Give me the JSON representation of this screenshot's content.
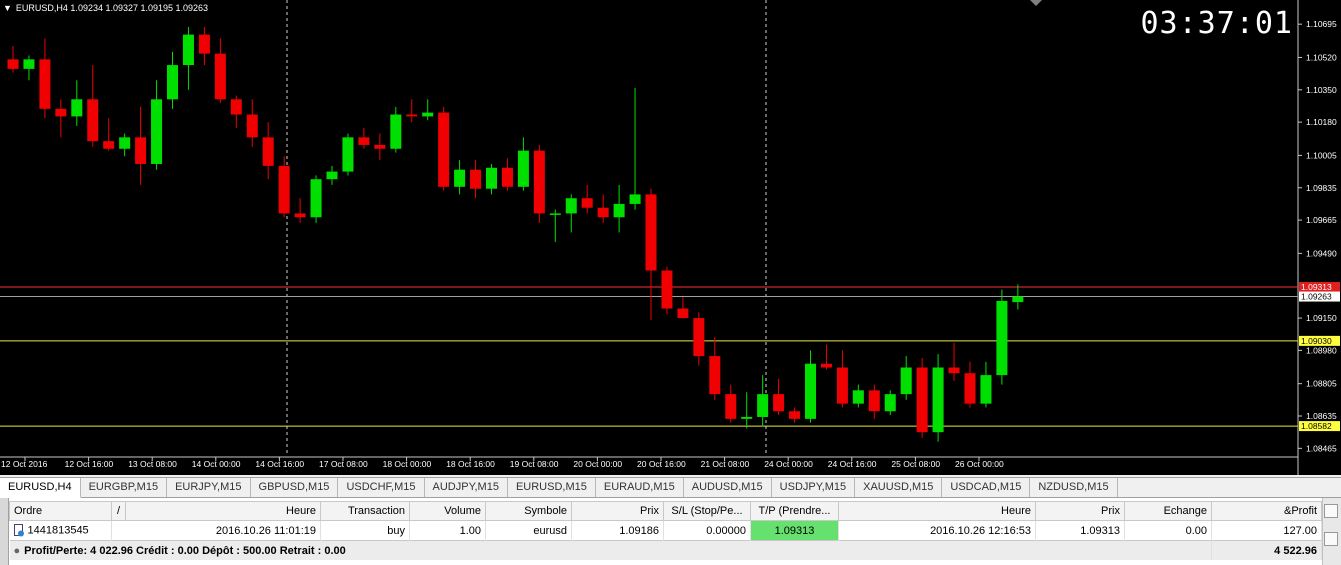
{
  "chart": {
    "symbol_info": "EURUSD,H4  1.09234 1.09327 1.09195 1.09263",
    "clock": "03:37:01",
    "price_min": 1.0843,
    "price_max": 1.1078,
    "price_ticks": [
      "1.10695",
      "1.10520",
      "1.10350",
      "1.10180",
      "1.10005",
      "1.09835",
      "1.09665",
      "1.09490",
      "1.09150",
      "1.08980",
      "1.08805",
      "1.08635",
      "1.08465"
    ],
    "time_ticks": [
      "12 Oct 2016",
      "12 Oct 16:00",
      "13 Oct 08:00",
      "14 Oct 00:00",
      "14 Oct 16:00",
      "17 Oct 08:00",
      "18 Oct 00:00",
      "18 Oct 16:00",
      "19 Oct 08:00",
      "20 Oct 00:00",
      "20 Oct 16:00",
      "21 Oct 08:00",
      "24 Oct 00:00",
      "24 Oct 16:00",
      "25 Oct 08:00",
      "26 Oct 00:00"
    ],
    "lines": [
      {
        "price": 1.09313,
        "label": "1.09313",
        "color": "#ff3030",
        "label_bg": "#e02020",
        "label_fg": "#ffffff"
      },
      {
        "price": 1.09263,
        "label": "1.09263",
        "color": "#a0a0a0",
        "label_bg": "#ffffff",
        "label_fg": "#000000"
      },
      {
        "price": 1.0903,
        "label": "1.09030",
        "color": "#e8e840",
        "label_bg": "#ffff40",
        "label_fg": "#000000"
      },
      {
        "price": 1.08582,
        "label": "1.08582",
        "color": "#e8e840",
        "label_bg": "#ffff40",
        "label_fg": "#000000"
      }
    ],
    "bull_color": "#00e000",
    "bear_color": "#f00000",
    "candles": [
      {
        "o": 1.1051,
        "h": 1.1058,
        "l": 1.1044,
        "c": 1.1046
      },
      {
        "o": 1.1046,
        "h": 1.1053,
        "l": 1.104,
        "c": 1.1051
      },
      {
        "o": 1.1051,
        "h": 1.1062,
        "l": 1.102,
        "c": 1.1025
      },
      {
        "o": 1.1025,
        "h": 1.103,
        "l": 1.101,
        "c": 1.1021
      },
      {
        "o": 1.1021,
        "h": 1.104,
        "l": 1.1016,
        "c": 1.103
      },
      {
        "o": 1.103,
        "h": 1.1048,
        "l": 1.1005,
        "c": 1.1008
      },
      {
        "o": 1.1008,
        "h": 1.102,
        "l": 1.1003,
        "c": 1.1004
      },
      {
        "o": 1.1004,
        "h": 1.1012,
        "l": 1.1,
        "c": 1.101
      },
      {
        "o": 1.101,
        "h": 1.1026,
        "l": 1.0985,
        "c": 1.0996
      },
      {
        "o": 1.0996,
        "h": 1.104,
        "l": 1.0993,
        "c": 1.103
      },
      {
        "o": 1.103,
        "h": 1.1055,
        "l": 1.1025,
        "c": 1.1048
      },
      {
        "o": 1.1048,
        "h": 1.1068,
        "l": 1.1035,
        "c": 1.1064
      },
      {
        "o": 1.1064,
        "h": 1.1068,
        "l": 1.1048,
        "c": 1.1054
      },
      {
        "o": 1.1054,
        "h": 1.1062,
        "l": 1.1028,
        "c": 1.103
      },
      {
        "o": 1.103,
        "h": 1.1032,
        "l": 1.1015,
        "c": 1.1022
      },
      {
        "o": 1.1022,
        "h": 1.103,
        "l": 1.1005,
        "c": 1.101
      },
      {
        "o": 1.101,
        "h": 1.1018,
        "l": 1.0988,
        "c": 1.0995
      },
      {
        "o": 1.0995,
        "h": 1.1,
        "l": 1.0968,
        "c": 1.097
      },
      {
        "o": 1.097,
        "h": 1.0978,
        "l": 1.0965,
        "c": 1.0968
      },
      {
        "o": 1.0968,
        "h": 1.099,
        "l": 1.0965,
        "c": 1.0988
      },
      {
        "o": 1.0988,
        "h": 1.0995,
        "l": 1.0985,
        "c": 1.0992
      },
      {
        "o": 1.0992,
        "h": 1.1012,
        "l": 1.099,
        "c": 1.101
      },
      {
        "o": 1.101,
        "h": 1.1015,
        "l": 1.1004,
        "c": 1.1006
      },
      {
        "o": 1.1006,
        "h": 1.1012,
        "l": 1.0998,
        "c": 1.1004
      },
      {
        "o": 1.1004,
        "h": 1.1026,
        "l": 1.1002,
        "c": 1.1022
      },
      {
        "o": 1.1022,
        "h": 1.103,
        "l": 1.1018,
        "c": 1.1021
      },
      {
        "o": 1.1021,
        "h": 1.103,
        "l": 1.1019,
        "c": 1.1023
      },
      {
        "o": 1.1023,
        "h": 1.1026,
        "l": 1.0982,
        "c": 1.0984
      },
      {
        "o": 1.0984,
        "h": 1.0998,
        "l": 1.098,
        "c": 1.0993
      },
      {
        "o": 1.0993,
        "h": 1.0998,
        "l": 1.0978,
        "c": 1.0983
      },
      {
        "o": 1.0983,
        "h": 1.0996,
        "l": 1.098,
        "c": 1.0994
      },
      {
        "o": 1.0994,
        "h": 1.0999,
        "l": 1.0982,
        "c": 1.0984
      },
      {
        "o": 1.0984,
        "h": 1.101,
        "l": 1.0982,
        "c": 1.1003
      },
      {
        "o": 1.1003,
        "h": 1.1006,
        "l": 1.0965,
        "c": 1.097
      },
      {
        "o": 1.097,
        "h": 1.0972,
        "l": 1.0955,
        "c": 1.097
      },
      {
        "o": 1.097,
        "h": 1.098,
        "l": 1.096,
        "c": 1.0978
      },
      {
        "o": 1.0978,
        "h": 1.0985,
        "l": 1.097,
        "c": 1.0973
      },
      {
        "o": 1.0973,
        "h": 1.098,
        "l": 1.0965,
        "c": 1.0968
      },
      {
        "o": 1.0968,
        "h": 1.0985,
        "l": 1.096,
        "c": 1.0975
      },
      {
        "o": 1.0975,
        "h": 1.1036,
        "l": 1.0972,
        "c": 1.098
      },
      {
        "o": 1.098,
        "h": 1.0983,
        "l": 1.0914,
        "c": 1.094
      },
      {
        "o": 1.094,
        "h": 1.0942,
        "l": 1.0917,
        "c": 1.092
      },
      {
        "o": 1.092,
        "h": 1.0926,
        "l": 1.0915,
        "c": 1.0915
      },
      {
        "o": 1.0915,
        "h": 1.0918,
        "l": 1.089,
        "c": 1.0895
      },
      {
        "o": 1.0895,
        "h": 1.0905,
        "l": 1.0872,
        "c": 1.0875
      },
      {
        "o": 1.0875,
        "h": 1.088,
        "l": 1.086,
        "c": 1.0862
      },
      {
        "o": 1.0862,
        "h": 1.0876,
        "l": 1.0857,
        "c": 1.0863
      },
      {
        "o": 1.0863,
        "h": 1.0885,
        "l": 1.0858,
        "c": 1.0875
      },
      {
        "o": 1.0875,
        "h": 1.0883,
        "l": 1.0864,
        "c": 1.0866
      },
      {
        "o": 1.0866,
        "h": 1.0868,
        "l": 1.086,
        "c": 1.0862
      },
      {
        "o": 1.0862,
        "h": 1.0898,
        "l": 1.086,
        "c": 1.0891
      },
      {
        "o": 1.0891,
        "h": 1.0901,
        "l": 1.0888,
        "c": 1.0889
      },
      {
        "o": 1.0889,
        "h": 1.0898,
        "l": 1.0868,
        "c": 1.087
      },
      {
        "o": 1.087,
        "h": 1.088,
        "l": 1.0868,
        "c": 1.0877
      },
      {
        "o": 1.0877,
        "h": 1.088,
        "l": 1.0862,
        "c": 1.0866
      },
      {
        "o": 1.0866,
        "h": 1.0877,
        "l": 1.0864,
        "c": 1.0875
      },
      {
        "o": 1.0875,
        "h": 1.0895,
        "l": 1.0872,
        "c": 1.0889
      },
      {
        "o": 1.0889,
        "h": 1.0894,
        "l": 1.0852,
        "c": 1.0855
      },
      {
        "o": 1.0855,
        "h": 1.0896,
        "l": 1.085,
        "c": 1.0889
      },
      {
        "o": 1.0889,
        "h": 1.0902,
        "l": 1.0882,
        "c": 1.0886
      },
      {
        "o": 1.0886,
        "h": 1.0892,
        "l": 1.0868,
        "c": 1.087
      },
      {
        "o": 1.087,
        "h": 1.0892,
        "l": 1.0868,
        "c": 1.0885
      },
      {
        "o": 1.0885,
        "h": 1.093,
        "l": 1.088,
        "c": 1.0924
      },
      {
        "o": 1.09234,
        "h": 1.09327,
        "l": 1.09195,
        "c": 1.09263
      }
    ]
  },
  "tabs": [
    "EURUSD,H4",
    "EURGBP,M15",
    "EURJPY,M15",
    "GBPUSD,M15",
    "USDCHF,M15",
    "AUDJPY,M15",
    "EURUSD,M15",
    "EURAUD,M15",
    "AUDUSD,M15",
    "USDJPY,M15",
    "XAUUSD,M15",
    "USDCAD,M15",
    "NZDUSD,M15"
  ],
  "terminal": {
    "headers": [
      "Ordre",
      "/",
      "Heure",
      "Transaction",
      "Volume",
      "Symbole",
      "Prix",
      "S/L (Stop/Pe...",
      "T/P (Prendre...",
      "Heure",
      "Prix",
      "Echange",
      "&Profit"
    ],
    "row": {
      "order": "1441813545",
      "time": "2016.10.26 11:01:19",
      "type": "buy",
      "volume": "1.00",
      "symbol": "eurusd",
      "price": "1.09186",
      "sl": "0.00000",
      "tp": "1.09313",
      "close_time": "2016.10.26 12:16:53",
      "close_price": "1.09313",
      "swap": "0.00",
      "profit": "127.00"
    },
    "summary": "Profit/Perte: 4 022.96  Crédit : 0.00  Dépôt : 500.00  Retrait : 0.00",
    "total": "4 522.96"
  }
}
